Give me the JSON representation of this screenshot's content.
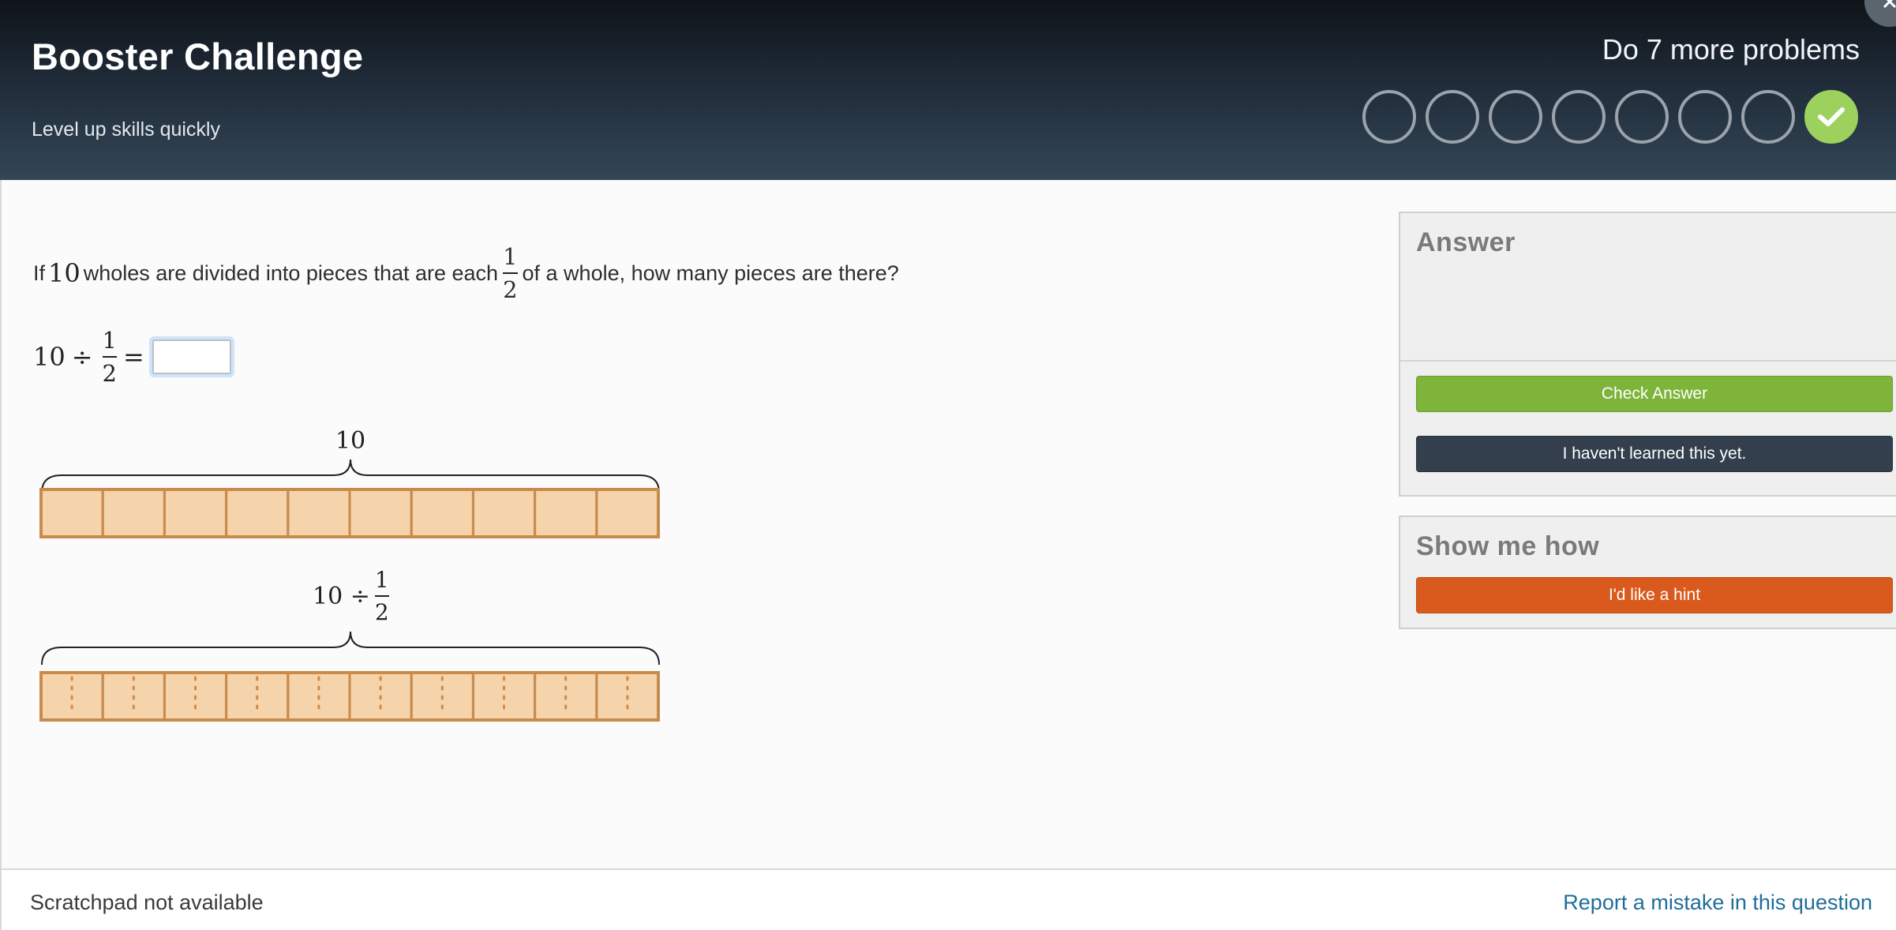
{
  "header": {
    "title": "Booster Challenge",
    "subtitle": "Level up skills quickly",
    "remaining": "Do 7 more problems",
    "progress": {
      "total": 8,
      "completed": 1
    }
  },
  "question": {
    "prefix": "If",
    "wholes": "10",
    "middle": "wholes are divided into pieces that are each",
    "frac_num": "1",
    "frac_den": "2",
    "suffix": "of a whole, how many pieces are there?"
  },
  "equation": {
    "left": "10",
    "op": "÷",
    "frac_num": "1",
    "frac_den": "2",
    "eq": "=",
    "input_value": ""
  },
  "diagram": {
    "top_label": "10",
    "bottom_label_left": "10 ÷",
    "bottom_frac_num": "1",
    "bottom_frac_den": "2",
    "cells": 10,
    "colors": {
      "fill": "#f5d3ab",
      "stroke": "#c98b4c",
      "dots": "#d08a45"
    }
  },
  "answer_panel": {
    "title": "Answer",
    "check_label": "Check Answer",
    "not_learned_label": "I haven't learned this yet."
  },
  "hint_panel": {
    "title": "Show me how",
    "hint_label": "I'd like a hint"
  },
  "footer": {
    "scratchpad": "Scratchpad not available",
    "report": "Report a mistake in this question"
  },
  "colors": {
    "check": "#7eb43a",
    "not_learned": "#333f4c",
    "hint": "#d95a1c",
    "progress_done": "#9cd15e",
    "link": "#1f6d9b"
  }
}
